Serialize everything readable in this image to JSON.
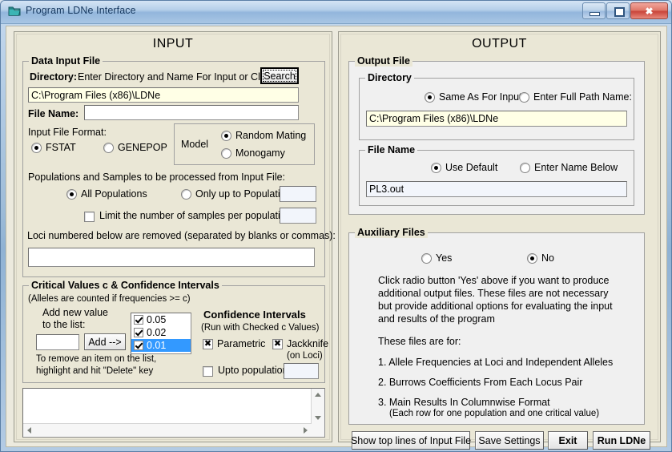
{
  "window": {
    "title": "Program LDNe Interface",
    "icon": "document-folder-icon",
    "minimize_label": "Minimize",
    "maximize_label": "Maximize",
    "close_label": "Close"
  },
  "input_panel": {
    "title": "INPUT",
    "data_input_file": {
      "legend": "Data Input File",
      "directory_label": "Directory:",
      "directory_hint": "Enter Directory and Name For Input or Click ->",
      "search_button": "Search",
      "directory_value": "C:\\Program Files (x86)\\LDNe",
      "file_name_label": "File Name:",
      "file_name_value": "",
      "input_format_label": "Input File Format:",
      "format_options": [
        {
          "label": "FSTAT",
          "selected": true
        },
        {
          "label": "GENEPOP",
          "selected": false
        }
      ],
      "model_label": "Model",
      "model_options": [
        {
          "label": "Random Mating",
          "selected": true
        },
        {
          "label": "Monogamy",
          "selected": false
        }
      ],
      "populations_label": "Populations and Samples to be processed from Input File:",
      "population_options": [
        {
          "label": "All Populations",
          "selected": true
        },
        {
          "label": "Only up to Population",
          "selected": false
        }
      ],
      "only_up_to_value": "",
      "limit_samples_label": "Limit the number of samples per population to",
      "limit_samples_checked": false,
      "limit_samples_value": "",
      "loci_removed_label": "Loci numbered below are removed (separated by blanks or commas):",
      "loci_removed_value": ""
    },
    "critical_values": {
      "legend": "Critical Values c & Confidence Intervals",
      "note": "(Alleles are counted if frequencies >= c)",
      "add_label_line1": "Add new value",
      "add_label_line2": "to the list:",
      "add_value": "",
      "add_button": "Add -->",
      "remove_hint_line1": "To remove an item on the list,",
      "remove_hint_line2": "highlight and hit \"Delete\" key",
      "c_values": [
        {
          "label": "0.05",
          "checked": true,
          "selected": false
        },
        {
          "label": "0.02",
          "checked": true,
          "selected": false
        },
        {
          "label": "0.01",
          "checked": true,
          "selected": true
        }
      ],
      "ci_title": "Confidence Intervals",
      "ci_subtitle": "(Run with Checked c Values)",
      "ci_options": [
        {
          "label": "Parametric",
          "checked": true
        },
        {
          "label": "Jackknife",
          "sublabel": "(on Loci)",
          "checked": true
        }
      ],
      "upto_population_label": "Upto population",
      "upto_population_checked": false,
      "upto_population_value": ""
    },
    "log_output": {
      "value": "",
      "scroll_up_icon": "scroll-up-arrow-icon",
      "scroll_down_icon": "scroll-down-arrow-icon",
      "scroll_left_icon": "scroll-left-arrow-icon",
      "scroll_right_icon": "scroll-right-arrow-icon"
    }
  },
  "output_panel": {
    "title": "OUTPUT",
    "output_file": {
      "legend": "Output File",
      "directory": {
        "legend": "Directory",
        "options": [
          {
            "label": "Same As For Input",
            "selected": true
          },
          {
            "label": "Enter Full Path Name:",
            "selected": false
          }
        ],
        "value": "C:\\Program Files (x86)\\LDNe"
      },
      "file_name": {
        "legend": "File Name",
        "options": [
          {
            "label": "Use Default",
            "selected": true
          },
          {
            "label": "Enter Name Below",
            "selected": false
          }
        ],
        "value": "PL3.out"
      }
    },
    "auxiliary_files": {
      "legend": "Auxiliary Files",
      "options": [
        {
          "label": "Yes",
          "selected": false
        },
        {
          "label": "No",
          "selected": true
        }
      ],
      "description": [
        "Click radio button 'Yes' above if you want to produce",
        "additional output files. These files are not necessary",
        "but provide additional options for evaluating the input",
        "and results of the program"
      ],
      "these_files_are_for": "These files are for:",
      "items": [
        "1. Allele Frequencies at Loci and Independent Alleles",
        "2. Burrows Coefficients From Each Locus Pair",
        "3. Main Results In Columnwise Format"
      ],
      "item3_note": "(Each row for one population and one critical value)"
    },
    "buttons": {
      "show_top_lines": "Show top lines of Input File",
      "save_settings": "Save Settings",
      "exit": "Exit",
      "run_ldne": "Run LDNe"
    }
  },
  "colors": {
    "panel_beige": "#eae7d6",
    "group_grey": "#f0f0f0",
    "field_yellow": "#ffffe6",
    "field_bluish": "#f2f5fb",
    "selection_blue": "#3399ff",
    "titlebar_blue": "#a9c6e4",
    "close_red": "#c9453a"
  }
}
